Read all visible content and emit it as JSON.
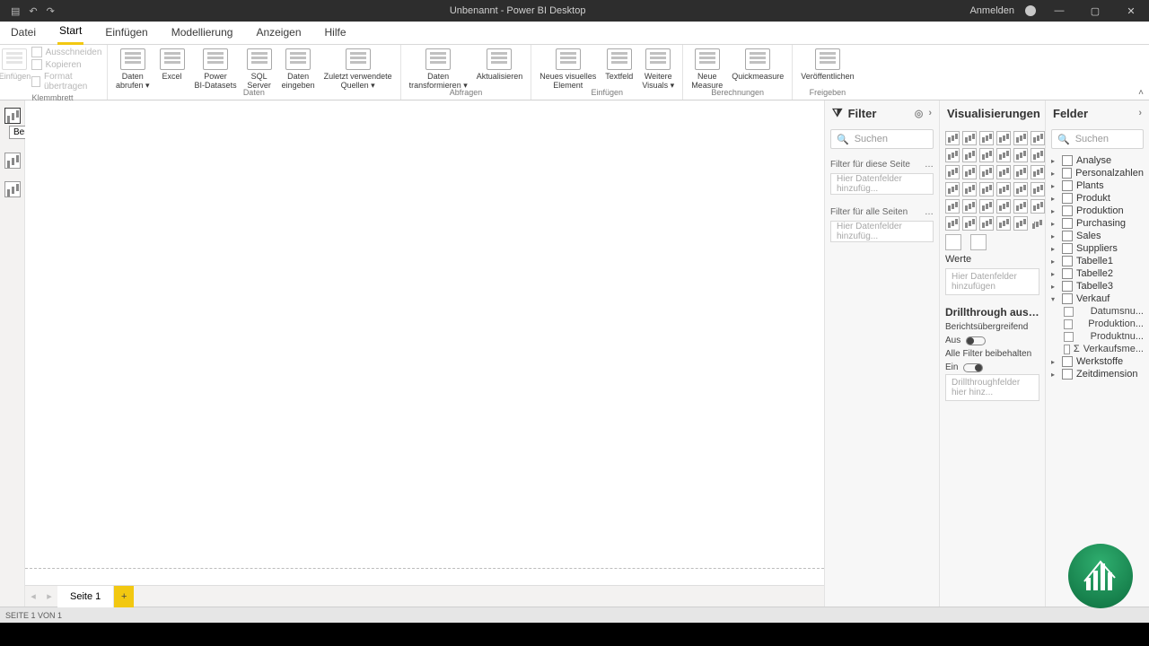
{
  "titlebar": {
    "title": "Unbenannt - Power BI Desktop",
    "signin": "Anmelden"
  },
  "menu": {
    "items": [
      "Datei",
      "Start",
      "Einfügen",
      "Modellierung",
      "Anzeigen",
      "Hilfe"
    ],
    "active": "Start"
  },
  "ribbon": {
    "clipboard": {
      "paste": "Einfügen",
      "cut": "Ausschneiden",
      "copy": "Kopieren",
      "formatpainter": "Format übertragen",
      "group": "Klemmbrett"
    },
    "data": {
      "getdata": "Daten\nabrufen ▾",
      "excel": "Excel",
      "pbi_datasets": "Power\nBI-Datasets",
      "sql": "SQL\nServer",
      "enterdata": "Daten\neingeben",
      "recent": "Zuletzt verwendete\nQuellen ▾",
      "group": "Daten"
    },
    "queries": {
      "transform": "Daten\ntransformieren ▾",
      "refresh": "Aktualisieren",
      "group": "Abfragen"
    },
    "insert": {
      "newvisual": "Neues visuelles\nElement",
      "textbox": "Textfeld",
      "morevisuals": "Weitere\nVisuals ▾",
      "group": "Einfügen"
    },
    "calc": {
      "newmeasure": "Neue\nMeasure",
      "quickmeasure": "Quickmeasure",
      "group": "Berechnungen"
    },
    "share": {
      "publish": "Veröffentlichen",
      "group": "Freigeben"
    }
  },
  "leftrail": {
    "tooltip": "Bericht"
  },
  "filters": {
    "title": "Filter",
    "search": "Suchen",
    "page_label": "Filter für diese Seite",
    "allpages_label": "Filter für alle Seiten",
    "drop_placeholder": "Hier Datenfelder hinzufüg..."
  },
  "viz": {
    "title": "Visualisierungen",
    "values": "Werte",
    "values_placeholder": "Hier Datenfelder hinzufügen",
    "drill_title": "Drillthrough ausfü...",
    "crossreport": "Berichtsübergreifend",
    "off": "Aus",
    "keepall": "Alle Filter beibehalten",
    "on": "Ein",
    "drill_placeholder": "Drillthroughfelder hier hinz..."
  },
  "fields": {
    "title": "Felder",
    "search": "Suchen",
    "tables": [
      "Analyse",
      "Personalzahlen",
      "Plants",
      "Produkt",
      "Produktion",
      "Purchasing",
      "Sales",
      "Suppliers",
      "Tabelle1",
      "Tabelle2",
      "Tabelle3",
      "Verkauf",
      "Werkstoffe",
      "Zeitdimension"
    ],
    "expanded_table": "Verkauf",
    "columns": [
      {
        "name": "Datumsnu...",
        "sigma": false
      },
      {
        "name": "Produktion...",
        "sigma": false
      },
      {
        "name": "Produktnu...",
        "sigma": false
      },
      {
        "name": "Verkaufsme...",
        "sigma": true
      }
    ]
  },
  "pages": {
    "tab1": "Seite 1"
  },
  "statusbar": {
    "text": "SEITE 1 VON 1"
  }
}
